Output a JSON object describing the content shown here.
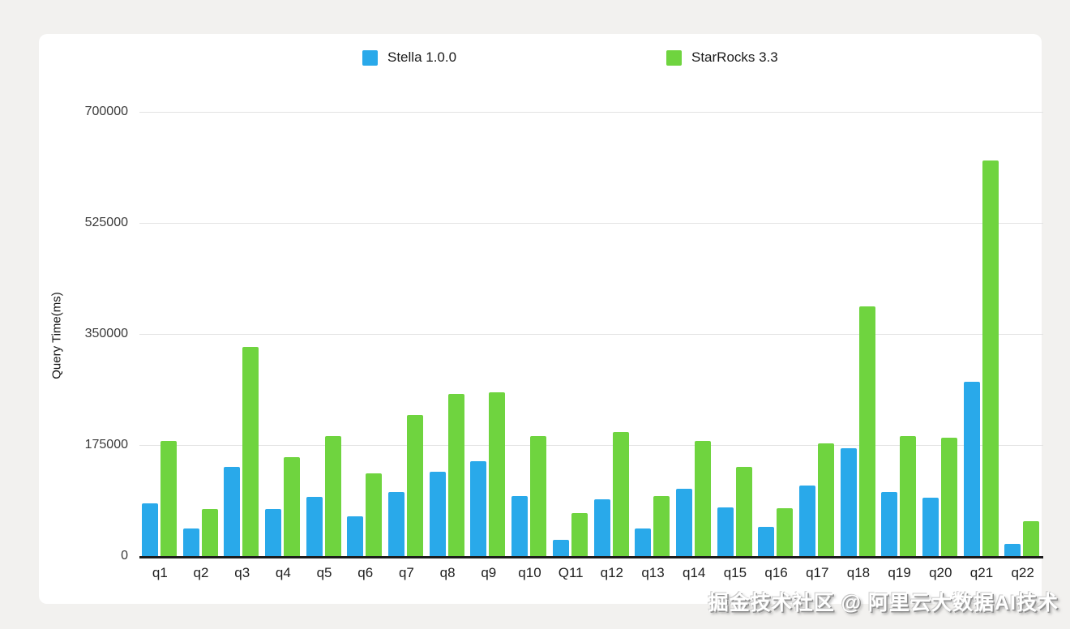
{
  "watermark": {
    "text": "掘金技术社区 @ 阿里云大数据AI技术"
  },
  "chart_data": {
    "type": "bar",
    "title": "",
    "xlabel": "",
    "ylabel": "Query Time(ms)",
    "ylim": [
      0,
      700000
    ],
    "yticks": [
      700000,
      525000,
      350000,
      175000,
      0
    ],
    "grid": true,
    "legend_position": "top",
    "categories": [
      "q1",
      "q2",
      "q3",
      "q4",
      "q5",
      "q6",
      "q7",
      "q8",
      "q9",
      "q10",
      "Q11",
      "q12",
      "q13",
      "q14",
      "q15",
      "q16",
      "q17",
      "q18",
      "q19",
      "q20",
      "q21",
      "q22"
    ],
    "series": [
      {
        "name": "Stella 1.0.0",
        "color": "#29A9EA",
        "values": [
          83000,
          43000,
          140000,
          74000,
          93000,
          63000,
          101000,
          133000,
          150000,
          94000,
          26000,
          89000,
          43000,
          106000,
          77000,
          46000,
          111000,
          170000,
          101000,
          92000,
          275000,
          19000
        ]
      },
      {
        "name": "StarRocks 3.3",
        "color": "#6FD43F",
        "values": [
          181000,
          74000,
          330000,
          156000,
          189000,
          130000,
          222000,
          256000,
          258000,
          189000,
          68000,
          196000,
          94000,
          181000,
          141000,
          75000,
          177000,
          394000,
          189000,
          186000,
          623000,
          55000
        ]
      }
    ]
  }
}
